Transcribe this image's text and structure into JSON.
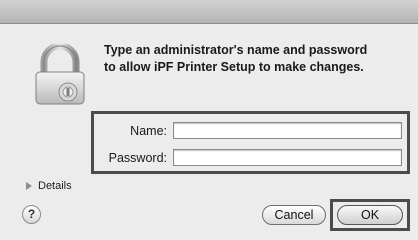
{
  "prompt": {
    "line1": "Type an administrator's name and password",
    "line2": "to allow iPF Printer Setup to make changes."
  },
  "fields": {
    "name_label": "Name:",
    "name_value": "",
    "password_label": "Password:",
    "password_value": ""
  },
  "details_label": "Details",
  "help_label": "?",
  "buttons": {
    "cancel": "Cancel",
    "ok": "OK"
  },
  "icons": {
    "lock": "padlock-icon",
    "details": "disclosure-triangle-icon",
    "help": "help-icon"
  }
}
